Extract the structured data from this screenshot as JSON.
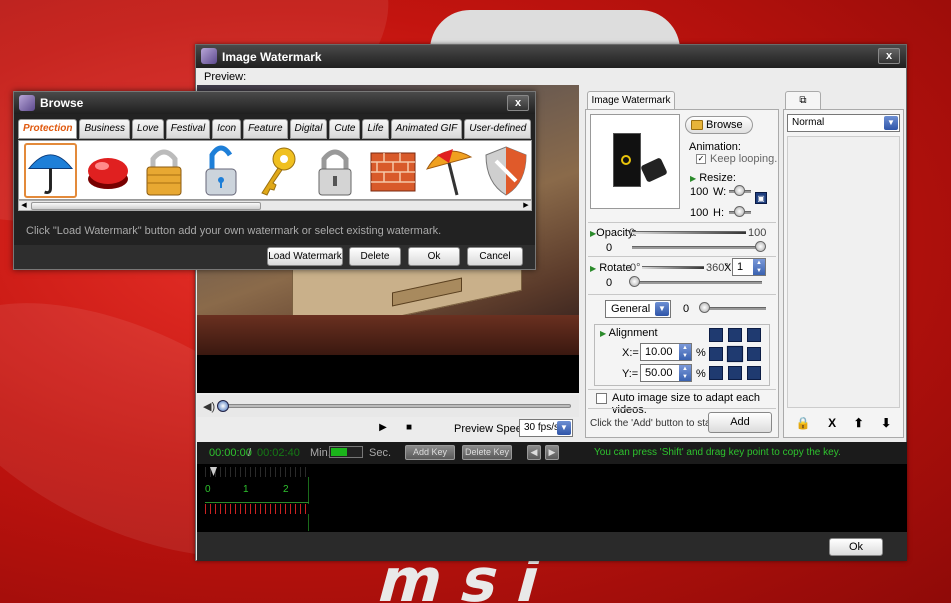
{
  "main_window": {
    "title": "Image Watermark",
    "close": "x",
    "preview_label": "Preview:",
    "controls": {
      "play": "▶",
      "stop": "■",
      "preview_speed_label": "Preview Speed:",
      "preview_speed_value": "30 fps/s"
    },
    "watermark_panel": {
      "tab": "Image Watermark",
      "browse": "Browse",
      "animation_label": "Animation:",
      "keep_looping": "Keep looping.",
      "resize_label": "Resize:",
      "resize_w_value": "100",
      "resize_h_value": "100",
      "w_label": "W:",
      "h_label": "H:",
      "opacity_label": "Opacity:",
      "opacity_min": "0",
      "opacity_max": "100",
      "opacity_value": "0",
      "rotate_label": "Rotate",
      "rotate_min": ":0°",
      "rotate_max": "360°",
      "rotate_x": "X",
      "rotate_count": "1",
      "rotate_value": "0",
      "general_select": "General",
      "general_value": "0",
      "alignment_label": "Alignment",
      "x_label": "X:=",
      "x_value": "10.00",
      "y_label": "Y:=",
      "y_value": "50.00",
      "percent": "%",
      "auto_size_label": "Auto image size to adapt each videos.",
      "click_add_hint": "Click the 'Add' button to start ->",
      "add_button": "Add"
    },
    "layer_panel": {
      "blend_mode": "Normal",
      "toolbar": [
        "🔒",
        "X",
        "⬆",
        "⬇"
      ]
    },
    "timeline": {
      "current_time": "00:00:00",
      "separator": "/",
      "total_time": "00:02:40",
      "min_label": "Min.",
      "sec_label": "Sec.",
      "add_key": "Add Key",
      "delete_key": "Delete Key",
      "prev_key": "◀",
      "next_key": "▶",
      "shift_hint": "You can press 'Shift' and drag key point to copy the key.",
      "ruler_labels": [
        "0",
        "1",
        "2"
      ]
    },
    "ok_button": "Ok"
  },
  "browse_dialog": {
    "title": "Browse",
    "close": "x",
    "categories": [
      "Protection",
      "Business",
      "Love",
      "Festival",
      "Icon",
      "Feature",
      "Digital",
      "Cute",
      "Life",
      "Animated GIF",
      "User-defined"
    ],
    "active_category": "Protection",
    "icons": [
      "umbrella-icon",
      "red-button-icon",
      "gold-padlock-icon",
      "blue-padlock-icon",
      "key-icon",
      "silver-padlock-icon",
      "brick-wall-icon",
      "beach-umbrella-icon",
      "shield-icon"
    ],
    "hint": "Click \"Load Watermark\" button add your own watermark or select existing watermark.",
    "buttons": {
      "load": "Load Watermark",
      "delete": "Delete",
      "ok": "Ok",
      "cancel": "Cancel"
    }
  },
  "colors": {
    "accent_green": "#2ec22e",
    "active_tab_orange": "#e05a10",
    "desktop_red": "#c3140f"
  }
}
